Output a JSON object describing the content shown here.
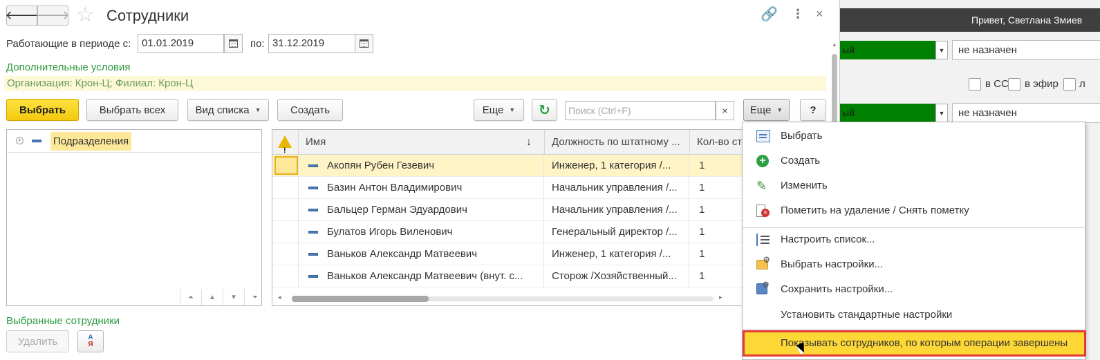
{
  "window": {
    "title": "Сотрудники"
  },
  "period": {
    "label": "Работающие в периоде с:",
    "from": "01.01.2019",
    "to_label": "по:",
    "to": "31.12.2019"
  },
  "extra_conditions": {
    "link": "Дополнительные условия",
    "filter_text": "Организация: Крон-Ц; Филиал: Крон-Ц"
  },
  "toolbar": {
    "select": "Выбрать",
    "select_all": "Выбрать всех",
    "view_list": "Вид списка",
    "create": "Создать",
    "more1": "Еще",
    "search_placeholder": "Поиск (Ctrl+F)",
    "clear": "×",
    "more2": "Еще",
    "help": "?"
  },
  "tree": {
    "root_label": "Подразделения"
  },
  "grid": {
    "columns": [
      "Имя",
      "Должность по штатному ...",
      "Кол-во ст"
    ],
    "rows": [
      {
        "name": "Акопян Рубен Гезевич",
        "position": "Инженер, 1 категория /...",
        "count": "1"
      },
      {
        "name": "Базин Антон Владимирович",
        "position": "Начальник управления /...",
        "count": "1"
      },
      {
        "name": "Бальцер Герман Эдуардович",
        "position": "Начальник управления /...",
        "count": "1"
      },
      {
        "name": "Булатов Игорь Виленович",
        "position": "Генеральный директор /...",
        "count": "1"
      },
      {
        "name": "Ваньков Александр Матвеевич",
        "position": "Инженер, 1 категория /...",
        "count": "1"
      },
      {
        "name": "Ваньков Александр Матвеевич (внут. с...",
        "position": "Сторож /Хозяйственный...",
        "count": "1"
      }
    ]
  },
  "selected": {
    "label": "Выбранные сотрудники",
    "delete": "Удалить"
  },
  "menu": {
    "items": [
      "Выбрать",
      "Создать",
      "Изменить",
      "Пометить на удаление / Снять пометку",
      "Настроить список...",
      "Выбрать настройки...",
      "Сохранить настройки...",
      "Установить стандартные настройки",
      "Показывать сотрудников, по которым операции завершены"
    ]
  },
  "background": {
    "greeting": "Привет, Светлана Змиев",
    "green_text": "ый",
    "assigned_1": "не назначен",
    "check_cc": "в СС",
    "check_air": "в эфир",
    "check_l": "л",
    "green_text_2": "ый",
    "assigned_2": "не назначен"
  },
  "colors": {
    "accent_yellow": "#f5c90e",
    "link_green": "#2e9a40",
    "highlight_red": "#e53935",
    "bg_green": "#008000"
  }
}
